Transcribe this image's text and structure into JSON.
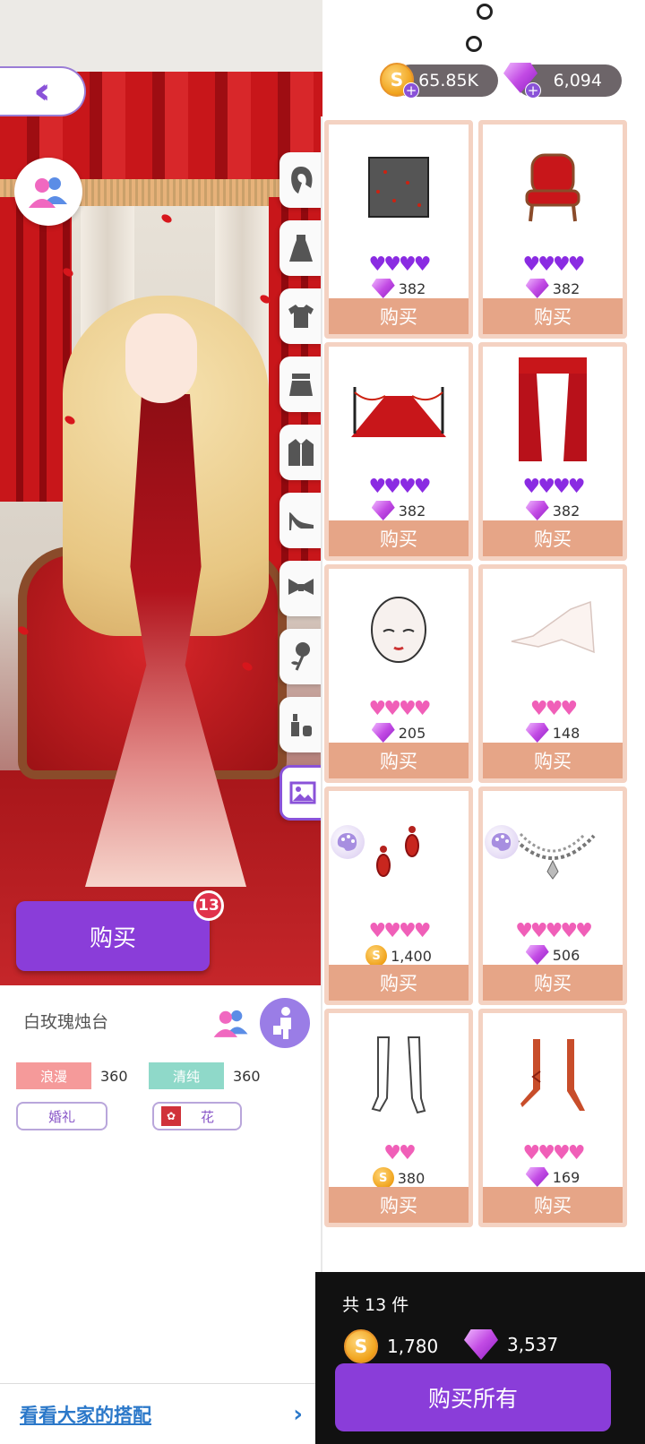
{
  "currency": {
    "coins": "65.85K",
    "gems": "6,094"
  },
  "scene": {
    "buy_label": "购买",
    "cart_count": "13"
  },
  "info": {
    "item_name": "白玫瑰烛台",
    "attributes": [
      {
        "label": "浪漫",
        "value": "360",
        "color": "#f59a9a"
      },
      {
        "label": "清纯",
        "value": "360",
        "color": "#8fd9c9"
      }
    ],
    "tags": [
      "婚礼",
      "花"
    ],
    "footer_link": "看看大家的搭配",
    "chevron": "›"
  },
  "categories": [
    "hair-icon",
    "dress-icon",
    "top-icon",
    "skirt-icon",
    "coat-icon",
    "heels-icon",
    "bow-icon",
    "rose-icon",
    "makeup-icon",
    "background-icon"
  ],
  "shop": {
    "buy_label": "购买",
    "items": [
      {
        "name": "rose-petal-background",
        "hearts": 4,
        "heart_color": "#8a2be2",
        "currency": "gem",
        "price": "382"
      },
      {
        "name": "red-throne-chair",
        "hearts": 4,
        "heart_color": "#8a2be2",
        "currency": "gem",
        "price": "382"
      },
      {
        "name": "red-carpet-rope",
        "hearts": 4,
        "heart_color": "#8a2be2",
        "currency": "gem",
        "price": "382"
      },
      {
        "name": "red-curtain",
        "hearts": 4,
        "heart_color": "#8a2be2",
        "currency": "gem",
        "price": "382"
      },
      {
        "name": "makeup-face",
        "hearts": 4,
        "heart_color": "#f05fb8",
        "currency": "gem",
        "price": "205"
      },
      {
        "name": "white-veil",
        "hearts": 3,
        "heart_color": "#f05fb8",
        "currency": "gem",
        "price": "148"
      },
      {
        "name": "red-earrings",
        "hearts": 4,
        "heart_color": "#f05fb8",
        "currency": "coin",
        "price": "1,400"
      },
      {
        "name": "crystal-necklace",
        "hearts": 5,
        "heart_color": "#f05fb8",
        "currency": "gem",
        "price": "506"
      },
      {
        "name": "white-stockings",
        "hearts": 2,
        "heart_color": "#f05fb8",
        "currency": "coin",
        "price": "380"
      },
      {
        "name": "red-heels",
        "hearts": 4,
        "heart_color": "#f05fb8",
        "currency": "gem",
        "price": "169"
      }
    ]
  },
  "checkout": {
    "count_label": "共 13 件",
    "coin_total": "1,780",
    "gem_total": "3,537",
    "buy_all_label": "购买所有"
  }
}
